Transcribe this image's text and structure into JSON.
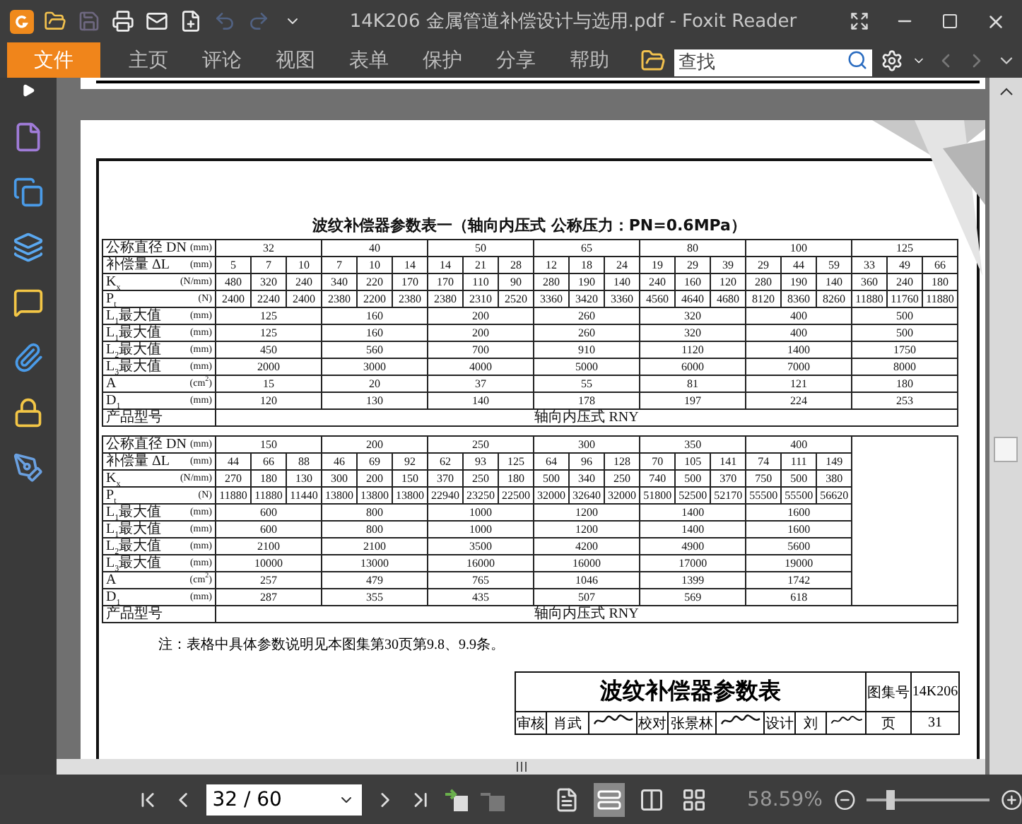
{
  "window": {
    "title": "14K206 金属管道补偿设计与选用.pdf - Foxit Reader"
  },
  "quick_access": [
    {
      "kind": "app",
      "disabled": false
    },
    {
      "kind": "open",
      "disabled": false
    },
    {
      "kind": "save",
      "disabled": true
    },
    {
      "kind": "print",
      "disabled": false
    },
    {
      "kind": "mail",
      "disabled": false
    },
    {
      "kind": "new",
      "disabled": false
    },
    {
      "kind": "undo",
      "disabled": true
    },
    {
      "kind": "redo",
      "disabled": true
    },
    {
      "kind": "more",
      "disabled": false
    }
  ],
  "tabs": [
    {
      "label": "文件",
      "selected": true
    },
    {
      "label": "主页",
      "selected": false
    },
    {
      "label": "评论",
      "selected": false
    },
    {
      "label": "视图",
      "selected": false
    },
    {
      "label": "表单",
      "selected": false
    },
    {
      "label": "保护",
      "selected": false
    },
    {
      "label": "分享",
      "selected": false
    },
    {
      "label": "帮助",
      "selected": false
    }
  ],
  "search": {
    "placeholder": "查找"
  },
  "sidebar": [
    {
      "kind": "expand"
    },
    {
      "kind": "page"
    },
    {
      "kind": "copy"
    },
    {
      "kind": "layers"
    },
    {
      "kind": "comment"
    },
    {
      "kind": "attach"
    },
    {
      "kind": "lock"
    },
    {
      "kind": "sign"
    }
  ],
  "document": {
    "table_title": "波纹补偿器参数表一（轴向内压式 公称压力：PN=0.6MPa）",
    "blocks": [
      {
        "rows": [
          {
            "label": "公称直径 DN",
            "unit": "(mm)",
            "kind": "group",
            "values": [
              "32",
              "40",
              "50",
              "65",
              "80",
              "100",
              "125"
            ]
          },
          {
            "label": "补偿量 ΔL",
            "unit": "(mm)",
            "kind": "each",
            "values": [
              "5",
              "7",
              "10",
              "7",
              "10",
              "14",
              "14",
              "21",
              "28",
              "12",
              "18",
              "24",
              "19",
              "29",
              "39",
              "29",
              "44",
              "59",
              "33",
              "49",
              "66"
            ]
          },
          {
            "label": "K$_{x}$",
            "unit": "(N/mm)",
            "kind": "each",
            "values": [
              "480",
              "320",
              "240",
              "340",
              "220",
              "170",
              "170",
              "110",
              "90",
              "280",
              "190",
              "140",
              "240",
              "160",
              "120",
              "280",
              "190",
              "140",
              "360",
              "240",
              "180"
            ]
          },
          {
            "label": "P$_{t}$",
            "unit": "(N)",
            "kind": "each",
            "values": [
              "2400",
              "2240",
              "2400",
              "2380",
              "2200",
              "2380",
              "2380",
              "2310",
              "2520",
              "3360",
              "3420",
              "3360",
              "4560",
              "4640",
              "4680",
              "8120",
              "8360",
              "8260",
              "11880",
              "11760",
              "11880"
            ]
          },
          {
            "label": "L$_{1}$最大值",
            "unit": "(mm)",
            "kind": "group",
            "values": [
              "125",
              "160",
              "200",
              "260",
              "320",
              "400",
              "500"
            ]
          },
          {
            "label": "L$_{1}$最大值",
            "unit": "(mm)",
            "kind": "group",
            "values": [
              "125",
              "160",
              "200",
              "260",
              "320",
              "400",
              "500"
            ]
          },
          {
            "label": "L$_{2}$最大值",
            "unit": "(mm)",
            "kind": "group",
            "values": [
              "450",
              "560",
              "700",
              "910",
              "1120",
              "1400",
              "1750"
            ]
          },
          {
            "label": "L$_{3}$最大值",
            "unit": "(mm)",
            "kind": "group",
            "values": [
              "2000",
              "3000",
              "4000",
              "5000",
              "6000",
              "7000",
              "8000"
            ]
          },
          {
            "label": "A",
            "unit": "(cm$^{2}$)",
            "kind": "group",
            "values": [
              "15",
              "20",
              "37",
              "55",
              "81",
              "121",
              "180"
            ]
          },
          {
            "label": "D$_{1}$",
            "unit": "(mm)",
            "kind": "group",
            "values": [
              "120",
              "130",
              "140",
              "178",
              "197",
              "224",
              "253"
            ]
          }
        ],
        "model_label": "产品型号",
        "model": "轴向内压式 RNY"
      },
      {
        "rows": [
          {
            "label": "公称直径 DN",
            "unit": "(mm)",
            "kind": "group",
            "values": [
              "150",
              "200",
              "250",
              "300",
              "350",
              "400"
            ]
          },
          {
            "label": "补偿量 ΔL",
            "unit": "(mm)",
            "kind": "each",
            "values": [
              "44",
              "66",
              "88",
              "46",
              "69",
              "92",
              "62",
              "93",
              "125",
              "64",
              "96",
              "128",
              "70",
              "105",
              "141",
              "74",
              "111",
              "149"
            ]
          },
          {
            "label": "K$_{x}$",
            "unit": "(N/mm)",
            "kind": "each",
            "values": [
              "270",
              "180",
              "130",
              "300",
              "200",
              "150",
              "370",
              "250",
              "180",
              "500",
              "340",
              "250",
              "740",
              "500",
              "370",
              "750",
              "500",
              "380"
            ]
          },
          {
            "label": "P$_{t}$",
            "unit": "(N)",
            "kind": "each",
            "values": [
              "11880",
              "11880",
              "11440",
              "13800",
              "13800",
              "13800",
              "22940",
              "23250",
              "22500",
              "32000",
              "32640",
              "32000",
              "51800",
              "52500",
              "52170",
              "55500",
              "55500",
              "56620"
            ]
          },
          {
            "label": "L$_{1}$最大值",
            "unit": "(mm)",
            "kind": "group",
            "values": [
              "600",
              "800",
              "1000",
              "1200",
              "1400",
              "1600"
            ]
          },
          {
            "label": "L$_{1}$最大值",
            "unit": "(mm)",
            "kind": "group",
            "values": [
              "600",
              "800",
              "1000",
              "1200",
              "1400",
              "1600"
            ]
          },
          {
            "label": "L$_{2}$最大值",
            "unit": "(mm)",
            "kind": "group",
            "values": [
              "2100",
              "2100",
              "3500",
              "4200",
              "4900",
              "5600"
            ]
          },
          {
            "label": "L$_{3}$最大值",
            "unit": "(mm)",
            "kind": "group",
            "values": [
              "10000",
              "13000",
              "16000",
              "16000",
              "17000",
              "19000"
            ]
          },
          {
            "label": "A",
            "unit": "(cm$^{2}$)",
            "kind": "group",
            "values": [
              "257",
              "479",
              "765",
              "1046",
              "1399",
              "1742"
            ]
          },
          {
            "label": "D$_{1}$",
            "unit": "(mm)",
            "kind": "group",
            "values": [
              "287",
              "355",
              "435",
              "507",
              "569",
              "618"
            ]
          }
        ],
        "model_label": "产品型号",
        "model": "轴向内压式 RNY"
      }
    ],
    "note": "注：表格中具体参数说明见本图集第30页第9.8、9.9条。",
    "title_block": {
      "title": "波纹补偿器参数表",
      "atlas_label": "图集号",
      "atlas_no": "14K206",
      "roles": [
        {
          "role": "审核",
          "name": "肖武"
        },
        {
          "role": "校对",
          "name": "张景林"
        },
        {
          "role": "设计",
          "name": "刘"
        }
      ],
      "page_label": "页",
      "page_no": "31"
    }
  },
  "status_bar": {
    "page": "32 / 60",
    "view_modes": [
      {
        "kind": "single",
        "selected": false
      },
      {
        "kind": "continuous",
        "selected": true
      },
      {
        "kind": "facing",
        "selected": false
      },
      {
        "kind": "cont-facing",
        "selected": false
      }
    ],
    "zoom": "58.59%",
    "zoom_slider": {
      "level": 0.2
    }
  }
}
